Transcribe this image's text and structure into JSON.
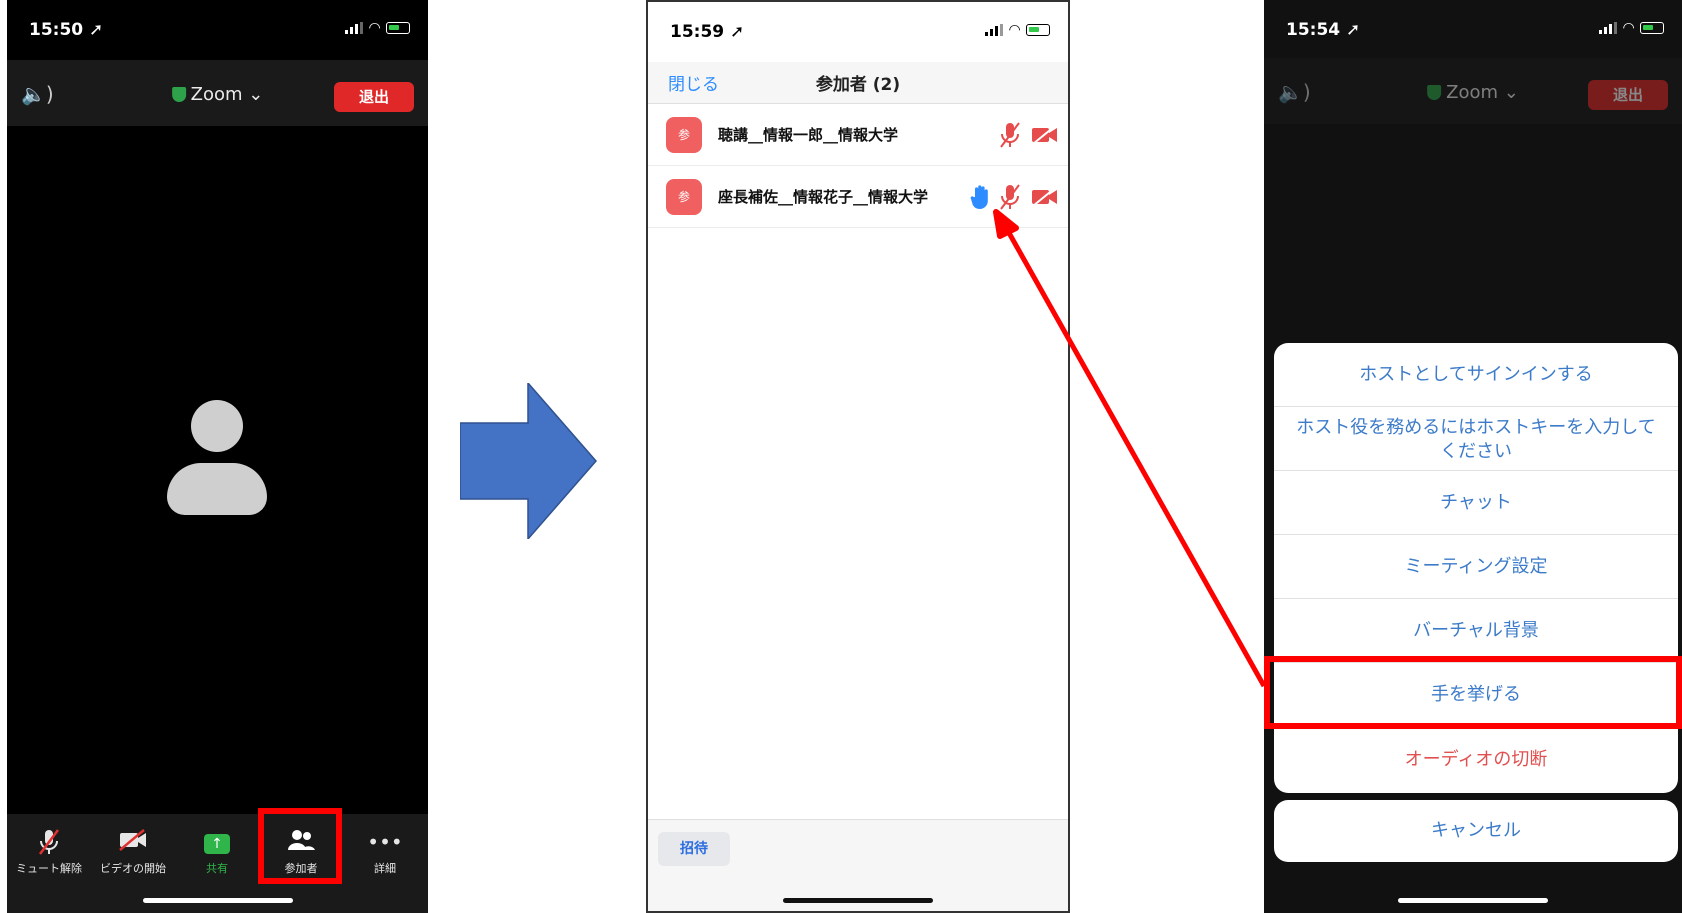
{
  "phone1": {
    "status_time": "15:50 ➚",
    "speaker_glyph": "🔈)",
    "meeting_label": "Zoom",
    "leave_label": "退出",
    "toolbar": {
      "unmute": "ミュート解除",
      "start_video": "ビデオの開始",
      "share": "共有",
      "participants": "参加者",
      "more": "詳細"
    }
  },
  "phone2": {
    "status_time": "15:59 ➚",
    "close_label": "閉じる",
    "title": "参加者 (2)",
    "participants": [
      {
        "avatar": "参",
        "name": "聴講__情報一郎__情報大学",
        "hand_raised": false
      },
      {
        "avatar": "参",
        "name": "座長補佐__情報花子__情報大学",
        "hand_raised": true
      }
    ],
    "invite_label": "招待"
  },
  "phone3": {
    "status_time": "15:54 ➚",
    "meeting_label": "Zoom",
    "leave_label": "退出",
    "menu": [
      "ホストとしてサインインする",
      "ホスト役を務めるにはホストキーを入力してください",
      "チャット",
      "ミーティング設定",
      "バーチャル背景",
      "手を挙げる",
      "オーディオの切断"
    ],
    "cancel_label": "キャンセル"
  },
  "colors": {
    "highlight": "#ff0000",
    "arrow_blue": "#4472c4",
    "link_blue": "#3c7bc9",
    "leave_red": "#e02828"
  }
}
